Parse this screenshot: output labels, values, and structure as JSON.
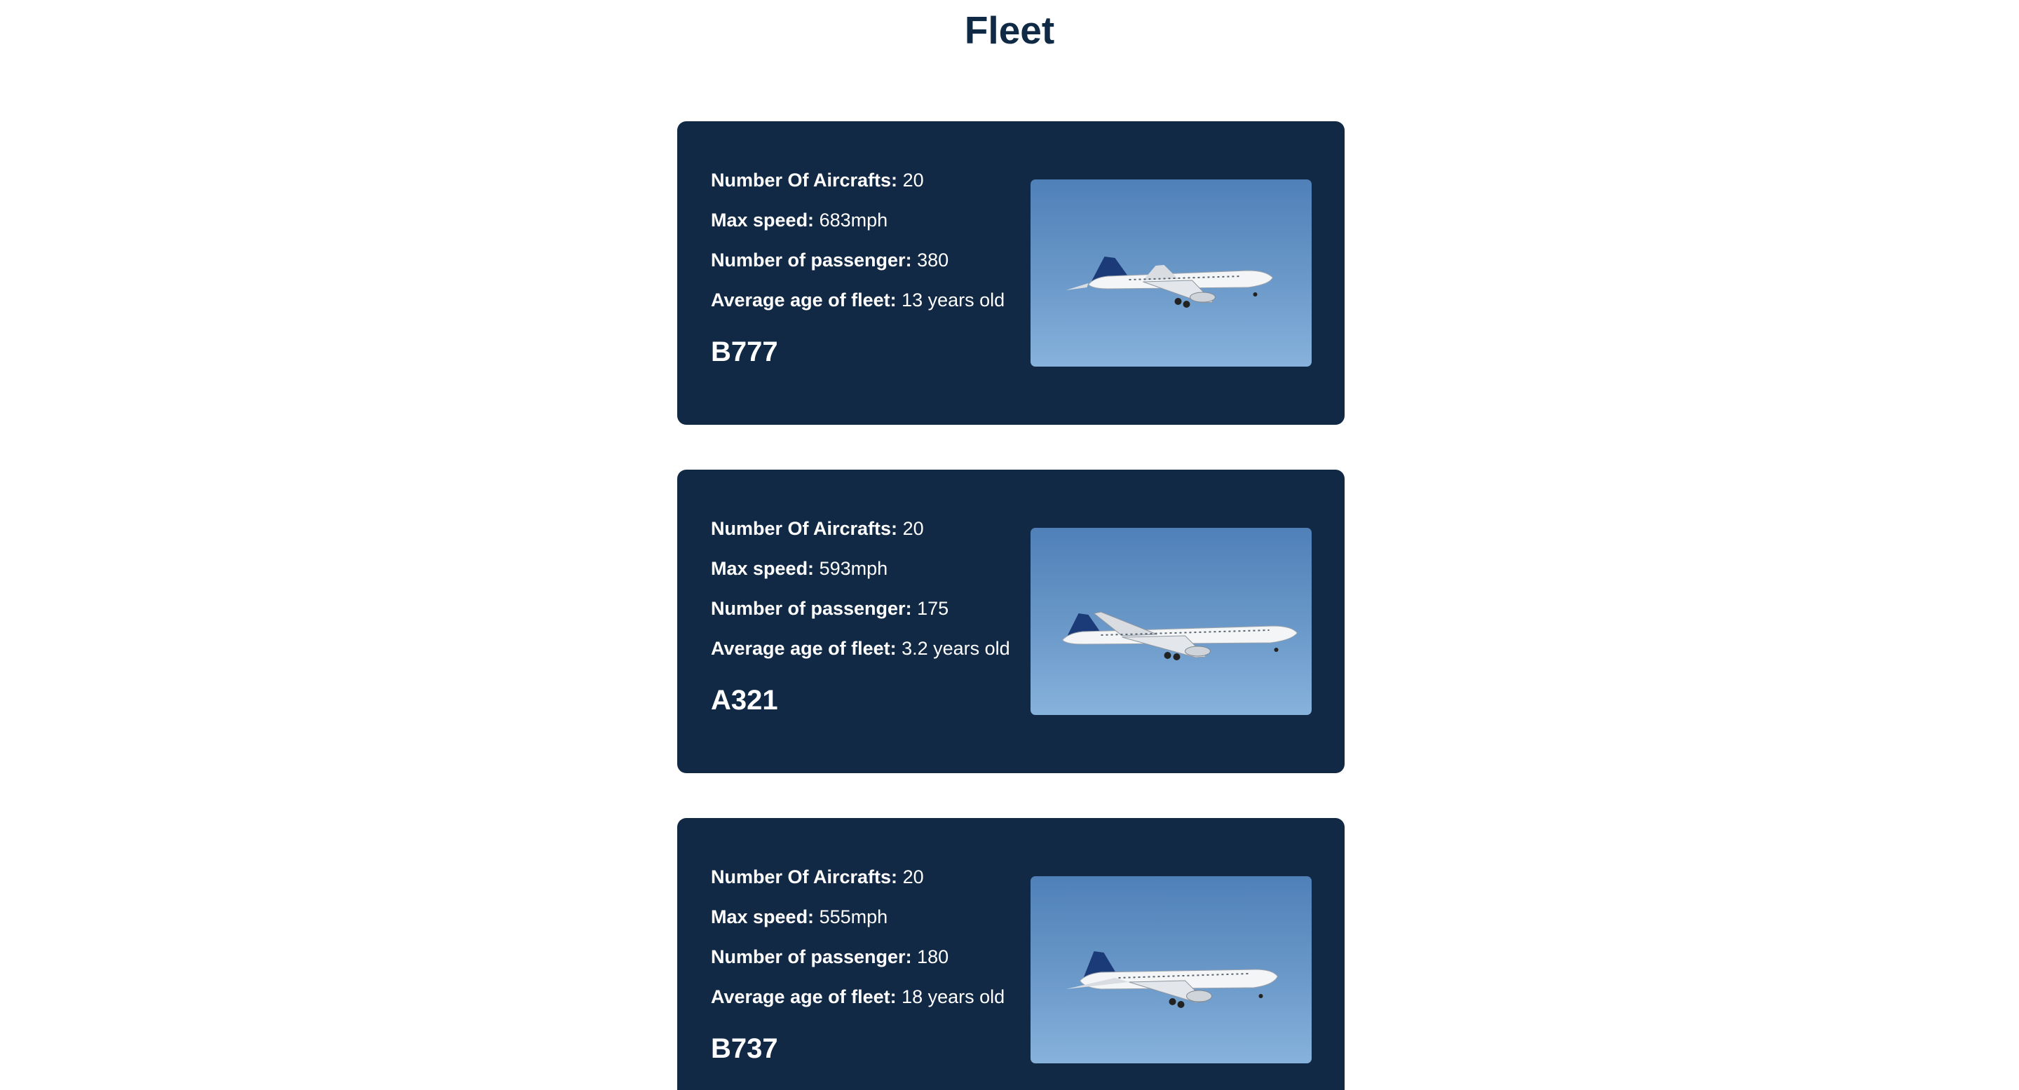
{
  "page": {
    "title": "Fleet"
  },
  "labels": {
    "aircraft_count": "Number Of Aircrafts:",
    "max_speed": "Max speed:",
    "passengers": "Number of passenger:",
    "avg_age": "Average age of fleet:"
  },
  "fleet": [
    {
      "model": "B777",
      "aircraft_count": "20",
      "max_speed": "683mph",
      "passengers": "380",
      "avg_age": "13 years old",
      "image": "airplane-photo"
    },
    {
      "model": "A321",
      "aircraft_count": "20",
      "max_speed": "593mph",
      "passengers": "175",
      "avg_age": "3.2 years old",
      "image": "airplane-photo"
    },
    {
      "model": "B737",
      "aircraft_count": "20",
      "max_speed": "555mph",
      "passengers": "180",
      "avg_age": "18 years old",
      "image": "airplane-photo"
    }
  ],
  "colors": {
    "title": "#102a45",
    "card_background": "#112944",
    "card_text": "#ffffff",
    "sky_top": "#4f80b8",
    "sky_bottom": "#86b2dc",
    "tail": "#1b3a78"
  }
}
